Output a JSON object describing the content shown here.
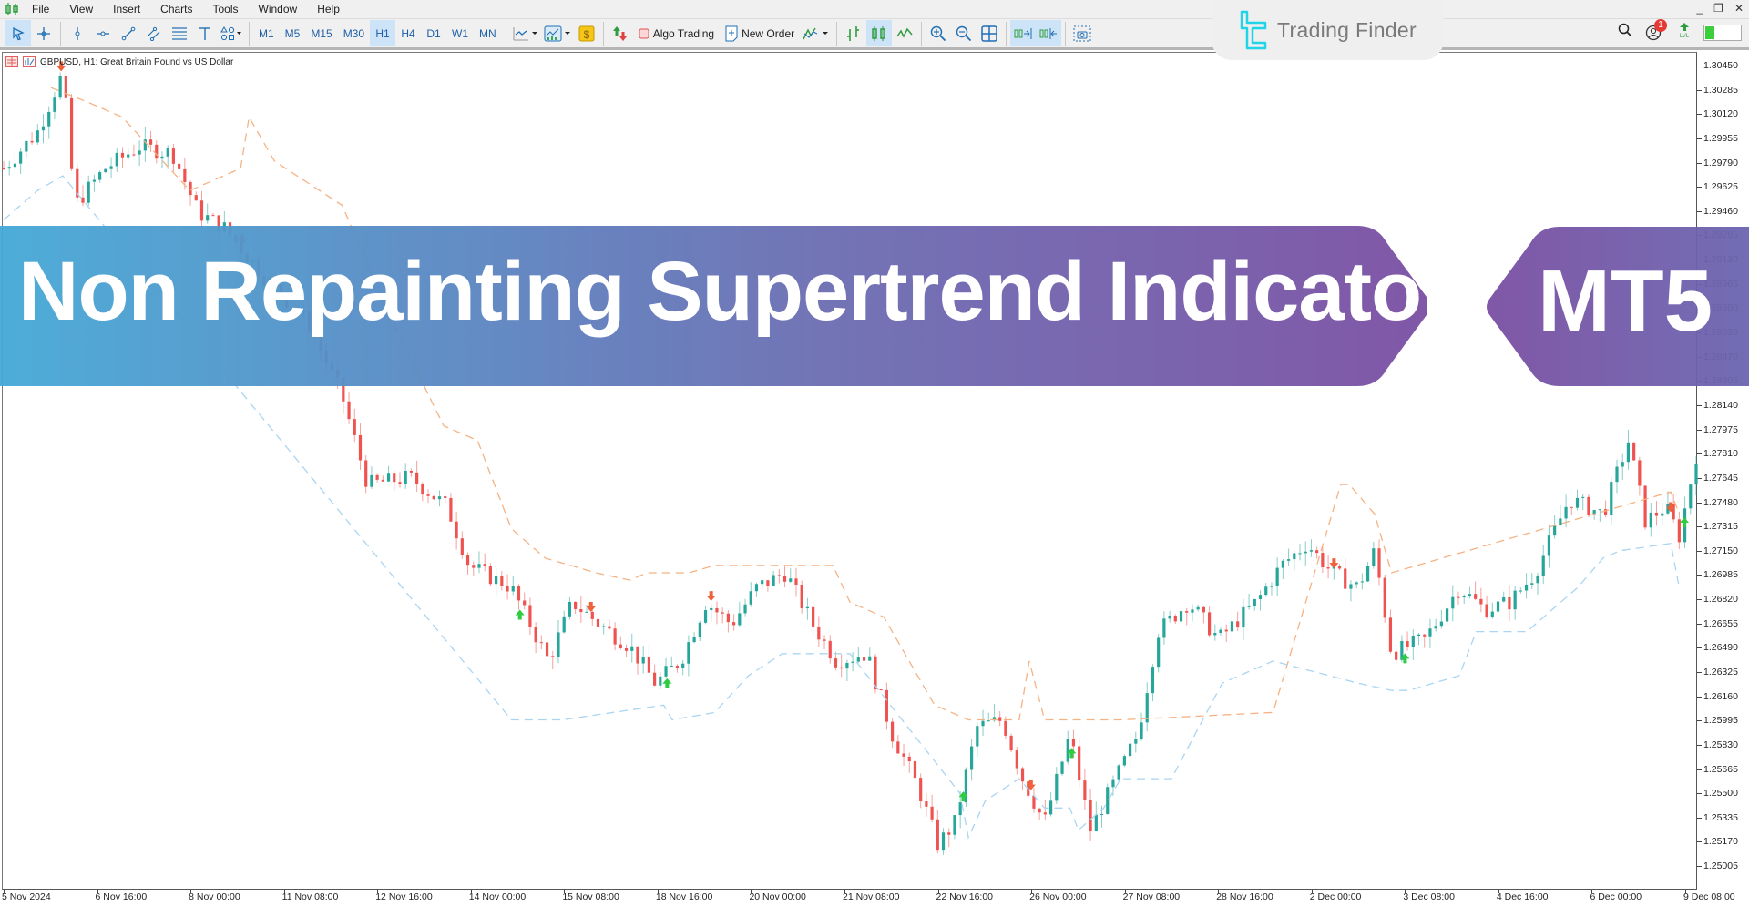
{
  "menubar": {
    "app_icon": "candlestick-app-icon",
    "items": [
      "File",
      "View",
      "Insert",
      "Charts",
      "Tools",
      "Window",
      "Help"
    ],
    "window_controls": {
      "minimize": "_",
      "restore": "❐",
      "close": "✕"
    }
  },
  "toolbar": {
    "drawing_tools": [
      "cursor",
      "crosshair",
      "vertical-line",
      "horizontal-line",
      "trendline",
      "channel",
      "fibonacci",
      "text",
      "shapes"
    ],
    "timeframes": [
      "M1",
      "M5",
      "M15",
      "M30",
      "H1",
      "H4",
      "D1",
      "W1",
      "MN"
    ],
    "active_timeframe": "H1",
    "algo_trading_label": "Algo Trading",
    "new_order_label": "New Order",
    "notification_count": "1"
  },
  "brand": {
    "name": "Trading Finder"
  },
  "chart": {
    "symbol_title": "GBPUSD, H1:  Great Britain Pound vs US Dollar",
    "colors": {
      "bull": "#26a69a",
      "bear": "#ef5350",
      "upper_band": "#f5b283",
      "lower_band": "#a9d5f2",
      "buy_arrow": "#2ecc40",
      "sell_arrow": "#f0603a"
    }
  },
  "banner": {
    "title": "Non Repainting Supertrend Indicator",
    "badge": "MT5",
    "gradient_start": "#45a9d6",
    "gradient_mid": "#6a6fb4",
    "gradient_end": "#7b4fa3"
  },
  "chart_data": {
    "type": "candlestick",
    "title": "GBPUSD, H1: Great Britain Pound vs US Dollar",
    "symbol": "GBPUSD",
    "timeframe": "H1",
    "y_ticks": [
      "1.30450",
      "1.30285",
      "1.30120",
      "1.29955",
      "1.29790",
      "1.29625",
      "1.29460",
      "1.29295",
      "1.29130",
      "1.28965",
      "1.28800",
      "1.28635",
      "1.28470",
      "1.28305",
      "1.28140",
      "1.27975",
      "1.27810",
      "1.27645",
      "1.27480",
      "1.27315",
      "1.27150",
      "1.26985",
      "1.26820",
      "1.26655",
      "1.26490",
      "1.26325",
      "1.26160",
      "1.25995",
      "1.25830",
      "1.25665",
      "1.25500",
      "1.25335",
      "1.25170",
      "1.25005"
    ],
    "ylim": [
      1.2487,
      1.305
    ],
    "x_ticks": [
      "5 Nov 2024",
      "6 Nov 16:00",
      "8 Nov 00:00",
      "11 Nov 08:00",
      "12 Nov 16:00",
      "14 Nov 00:00",
      "15 Nov 08:00",
      "18 Nov 16:00",
      "20 Nov 00:00",
      "21 Nov 08:00",
      "22 Nov 16:00",
      "26 Nov 00:00",
      "27 Nov 08:00",
      "28 Nov 16:00",
      "2 Dec 00:00",
      "3 Dec 08:00",
      "4 Dec 16:00",
      "6 Dec 00:00",
      "9 Dec 08:00"
    ],
    "price_path": [
      [
        0,
        1.2975
      ],
      [
        0.02,
        1.3
      ],
      [
        0.035,
        1.304
      ],
      [
        0.042,
        1.295
      ],
      [
        0.06,
        1.2975
      ],
      [
        0.08,
        1.299
      ],
      [
        0.1,
        1.2985
      ],
      [
        0.115,
        1.2945
      ],
      [
        0.13,
        1.2935
      ],
      [
        0.155,
        1.29
      ],
      [
        0.18,
        1.287
      ],
      [
        0.2,
        1.282
      ],
      [
        0.215,
        1.276
      ],
      [
        0.24,
        1.2765
      ],
      [
        0.262,
        1.2745
      ],
      [
        0.275,
        1.2705
      ],
      [
        0.3,
        1.269
      ],
      [
        0.322,
        1.264
      ],
      [
        0.336,
        1.268
      ],
      [
        0.352,
        1.2665
      ],
      [
        0.37,
        1.265
      ],
      [
        0.385,
        1.2625
      ],
      [
        0.4,
        1.264
      ],
      [
        0.415,
        1.268
      ],
      [
        0.43,
        1.2665
      ],
      [
        0.445,
        1.269
      ],
      [
        0.462,
        1.27
      ],
      [
        0.478,
        1.2665
      ],
      [
        0.492,
        1.264
      ],
      [
        0.51,
        1.2645
      ],
      [
        0.525,
        1.259
      ],
      [
        0.54,
        1.2555
      ],
      [
        0.552,
        1.2515
      ],
      [
        0.562,
        1.253
      ],
      [
        0.575,
        1.2595
      ],
      [
        0.59,
        1.26
      ],
      [
        0.602,
        1.256
      ],
      [
        0.615,
        1.253
      ],
      [
        0.63,
        1.259
      ],
      [
        0.642,
        1.2525
      ],
      [
        0.655,
        1.2555
      ],
      [
        0.67,
        1.259
      ],
      [
        0.682,
        1.266
      ],
      [
        0.7,
        1.268
      ],
      [
        0.718,
        1.2655
      ],
      [
        0.74,
        1.268
      ],
      [
        0.755,
        1.2705
      ],
      [
        0.77,
        1.272
      ],
      [
        0.785,
        1.27
      ],
      [
        0.8,
        1.269
      ],
      [
        0.81,
        1.2715
      ],
      [
        0.82,
        1.2645
      ],
      [
        0.84,
        1.2655
      ],
      [
        0.86,
        1.269
      ],
      [
        0.875,
        1.2675
      ],
      [
        0.89,
        1.268
      ],
      [
        0.905,
        1.27
      ],
      [
        0.925,
        1.275
      ],
      [
        0.945,
        1.274
      ],
      [
        0.96,
        1.279
      ],
      [
        0.97,
        1.2735
      ],
      [
        0.982,
        1.2745
      ],
      [
        0.99,
        1.2725
      ],
      [
        1,
        1.278
      ]
    ],
    "upper_band_path": [
      [
        0.028,
        1.303
      ],
      [
        0.05,
        1.302
      ],
      [
        0.07,
        1.301
      ],
      [
        0.09,
        1.2985
      ],
      [
        0.11,
        1.296
      ],
      [
        0.14,
        1.2975
      ],
      [
        0.145,
        1.301
      ],
      [
        0.16,
        1.298
      ],
      [
        0.2,
        1.295
      ],
      [
        0.23,
        1.287
      ],
      [
        0.26,
        1.28
      ],
      [
        0.28,
        1.279
      ],
      [
        0.3,
        1.273
      ],
      [
        0.32,
        1.271
      ],
      [
        0.35,
        1.27
      ],
      [
        0.37,
        1.2695
      ],
      [
        0.38,
        1.27
      ],
      [
        0.39,
        1.27
      ],
      [
        0.405,
        1.27
      ],
      [
        0.42,
        1.2705
      ],
      [
        0.44,
        1.2705
      ],
      [
        0.49,
        1.2705
      ],
      [
        0.5,
        1.268
      ],
      [
        0.52,
        1.267
      ],
      [
        0.535,
        1.264
      ],
      [
        0.55,
        1.261
      ],
      [
        0.57,
        1.26
      ],
      [
        0.6,
        1.26
      ],
      [
        0.606,
        1.264
      ],
      [
        0.615,
        1.26
      ],
      [
        0.65,
        1.26
      ],
      [
        0.66,
        1.26
      ],
      [
        0.75,
        1.2605
      ],
      [
        0.79,
        1.276
      ],
      [
        0.795,
        1.276
      ],
      [
        0.81,
        1.274
      ],
      [
        0.82,
        1.27
      ],
      [
        0.985,
        1.2755
      ],
      [
        0.99,
        1.274
      ]
    ],
    "lower_band_path": [
      [
        0,
        1.294
      ],
      [
        0.02,
        1.296
      ],
      [
        0.035,
        1.297
      ],
      [
        0.3,
        1.26
      ],
      [
        0.305,
        1.26
      ],
      [
        0.33,
        1.26
      ],
      [
        0.39,
        1.261
      ],
      [
        0.395,
        1.26
      ],
      [
        0.42,
        1.2605
      ],
      [
        0.44,
        1.263
      ],
      [
        0.46,
        1.2645
      ],
      [
        0.5,
        1.2645
      ],
      [
        0.565,
        1.255
      ],
      [
        0.57,
        1.252
      ],
      [
        0.58,
        1.2545
      ],
      [
        0.6,
        1.256
      ],
      [
        0.615,
        1.254
      ],
      [
        0.63,
        1.254
      ],
      [
        0.635,
        1.2525
      ],
      [
        0.65,
        1.254
      ],
      [
        0.66,
        1.256
      ],
      [
        0.68,
        1.256
      ],
      [
        0.69,
        1.256
      ],
      [
        0.72,
        1.2625
      ],
      [
        0.75,
        1.264
      ],
      [
        0.8,
        1.2625
      ],
      [
        0.82,
        1.262
      ],
      [
        0.83,
        1.262
      ],
      [
        0.86,
        1.263
      ],
      [
        0.87,
        1.266
      ],
      [
        0.9,
        1.266
      ],
      [
        0.93,
        1.269
      ],
      [
        0.945,
        1.271
      ],
      [
        0.955,
        1.2715
      ],
      [
        0.985,
        1.272
      ],
      [
        0.99,
        1.269
      ]
    ],
    "signals": [
      {
        "pos": 0.034,
        "type": "sell"
      },
      {
        "pos": 0.141,
        "type": "sell"
      },
      {
        "pos": 0.305,
        "type": "buy"
      },
      {
        "pos": 0.347,
        "type": "sell"
      },
      {
        "pos": 0.392,
        "type": "buy"
      },
      {
        "pos": 0.418,
        "type": "sell"
      },
      {
        "pos": 0.567,
        "type": "buy"
      },
      {
        "pos": 0.607,
        "type": "sell"
      },
      {
        "pos": 0.631,
        "type": "buy"
      },
      {
        "pos": 0.786,
        "type": "sell"
      },
      {
        "pos": 0.828,
        "type": "buy"
      },
      {
        "pos": 0.985,
        "type": "sell"
      },
      {
        "pos": 0.993,
        "type": "buy"
      }
    ]
  }
}
